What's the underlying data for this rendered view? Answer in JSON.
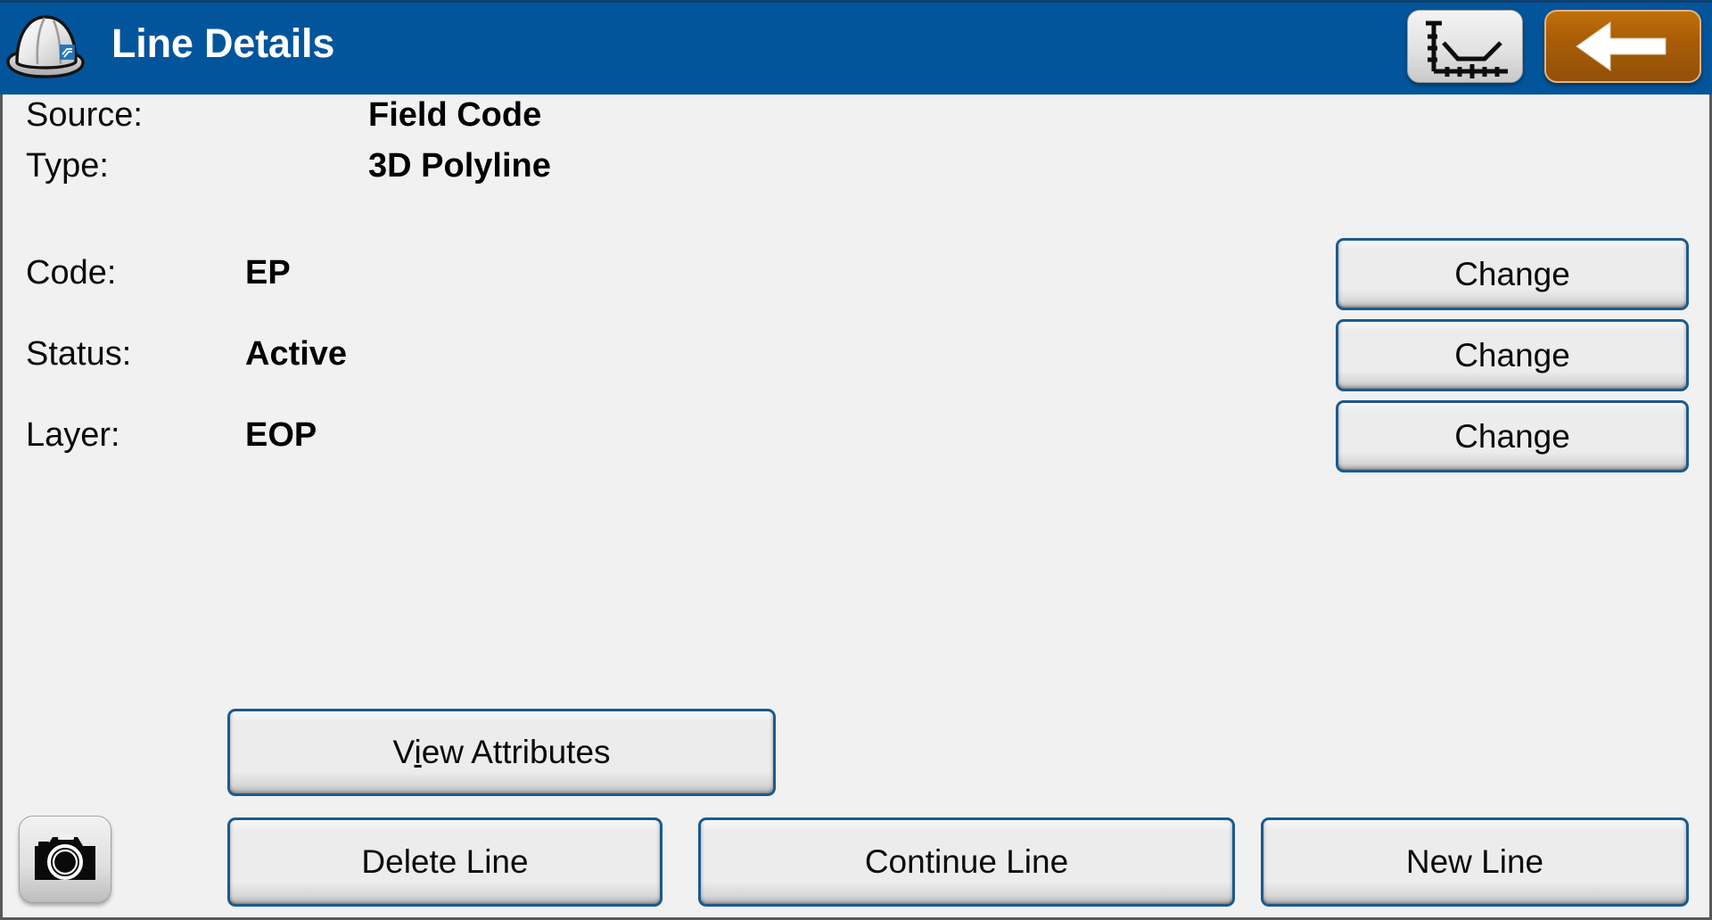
{
  "window": {
    "title": "Line Details",
    "background_color": "#f1f1f1",
    "header_color": "#03559b",
    "accent_border_color": "#1b5a8e",
    "back_button_color": "#aa5d05"
  },
  "header": {
    "title": "Line Details",
    "logo_icon": "hard-hat-icon",
    "profile_button_icon": "cross-section-graph-icon",
    "back_button_icon": "left-arrow-icon"
  },
  "details": {
    "source": {
      "label": "Source:",
      "value": "Field Code"
    },
    "type": {
      "label": "Type:",
      "value": "3D Polyline"
    },
    "code": {
      "label": "Code:",
      "value": "EP"
    },
    "status": {
      "label": "Status:",
      "value": "Active"
    },
    "layer": {
      "label": "Layer:",
      "value": "EOP"
    }
  },
  "change_buttons": {
    "code_label": "Change",
    "status_label": "Change",
    "layer_label": "Change"
  },
  "actions": {
    "view_attributes": {
      "prefix": "V",
      "accel": "i",
      "suffix": "ew Attributes"
    },
    "delete_line": "Delete Line",
    "continue_line": "Continue Line",
    "new_line": "New Line"
  },
  "footer": {
    "camera_button_icon": "camera-icon"
  }
}
